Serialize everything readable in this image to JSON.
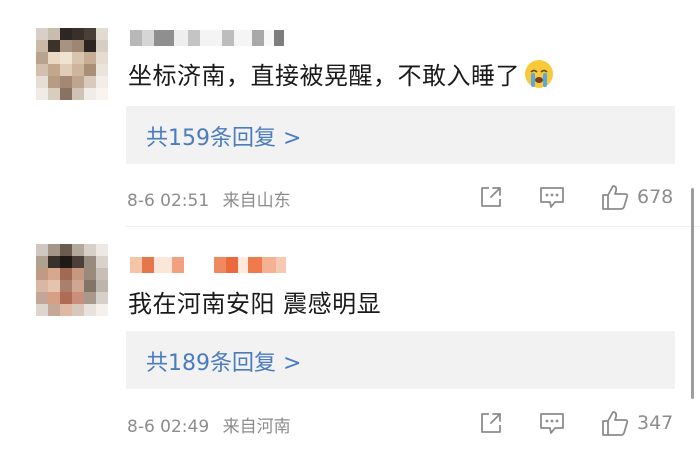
{
  "comments": [
    {
      "text": "坐标济南，直接被晃醒，不敢入睡了",
      "emoji": "crying-face-emoji",
      "replies_label": "共159条回复 >",
      "date": "8-6 02:51",
      "location": "来自山东",
      "likes": "678"
    },
    {
      "text": "我在河南安阳 震感明显",
      "replies_label": "共189条回复 >",
      "date": "8-6 02:49",
      "location": "来自河南",
      "likes": "347"
    }
  ],
  "icons": {
    "share": "share-icon",
    "comment": "comment-icon",
    "like": "thumbs-up-icon"
  },
  "colors": {
    "reply_link": "#4a7cbf",
    "reply_bg": "#f2f2f2",
    "meta_text": "#8c8c8c",
    "comment_text": "#1a1a1a"
  }
}
